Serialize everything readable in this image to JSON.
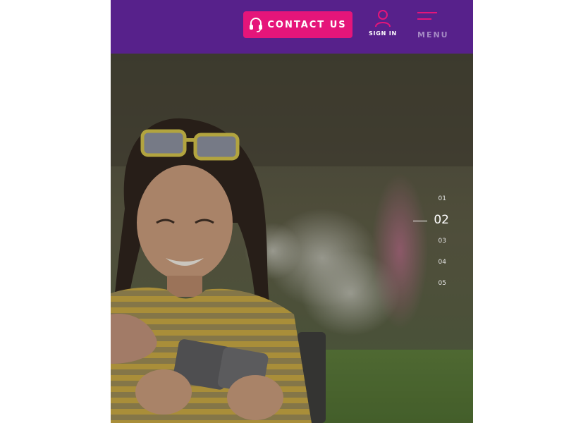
{
  "header": {
    "contact_label": "CONTACT US",
    "signin_label": "SIGN IN",
    "menu_label": "MENU",
    "icons": {
      "contact": "headset-icon",
      "signin": "user-icon",
      "menu": "hamburger-icon"
    },
    "colors": {
      "header_bg": "#57218b",
      "accent": "#e5157a",
      "menu_label": "#a58ac4"
    }
  },
  "slider": {
    "pages": [
      "01",
      "02",
      "03",
      "04",
      "05"
    ],
    "active": "02"
  }
}
